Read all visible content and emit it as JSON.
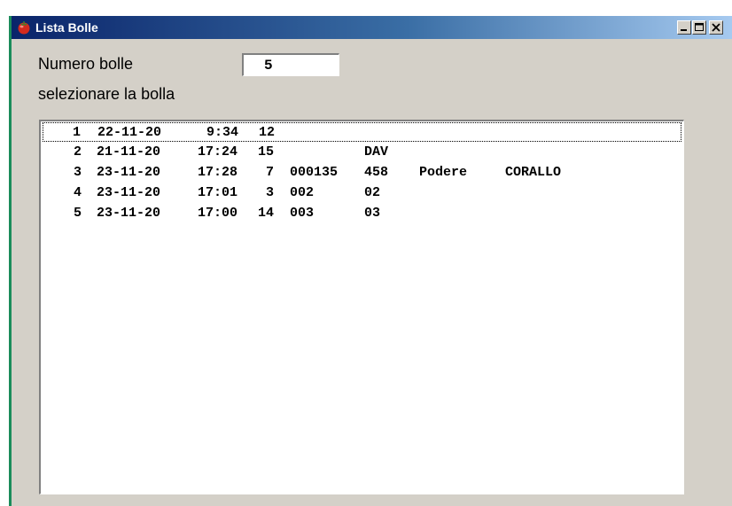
{
  "window": {
    "title": "Lista Bolle",
    "controls": {
      "minimize": "minimize",
      "maximize": "maximize",
      "close": "close"
    }
  },
  "form": {
    "numero_label": "Numero bolle",
    "numero_value": "5",
    "select_label": "selezionare la bolla"
  },
  "list": {
    "rows": [
      {
        "num": "1",
        "date": "22-11-20",
        "time": "9:34",
        "qty": "12",
        "code": "",
        "ref": "",
        "place": "",
        "name": ""
      },
      {
        "num": "2",
        "date": "21-11-20",
        "time": "17:24",
        "qty": "15",
        "code": "",
        "ref": "DAV",
        "place": "",
        "name": ""
      },
      {
        "num": "3",
        "date": "23-11-20",
        "time": "17:28",
        "qty": "7",
        "code": "000135",
        "ref": "458",
        "place": "Podere",
        "name": "CORALLO"
      },
      {
        "num": "4",
        "date": "23-11-20",
        "time": "17:01",
        "qty": "3",
        "code": "002",
        "ref": "02",
        "place": "",
        "name": ""
      },
      {
        "num": "5",
        "date": "23-11-20",
        "time": "17:00",
        "qty": "14",
        "code": "003",
        "ref": "03",
        "place": "",
        "name": ""
      }
    ],
    "focused_index": 0
  },
  "colors": {
    "titlebar_start": "#0a246a",
    "titlebar_end": "#a6caf0",
    "window_bg": "#d4d0c8",
    "accent_strip": "#1a8c5a"
  },
  "icons": {
    "app": "tomato-icon",
    "minimize": "minimize-icon",
    "maximize": "maximize-icon",
    "close": "close-icon"
  }
}
